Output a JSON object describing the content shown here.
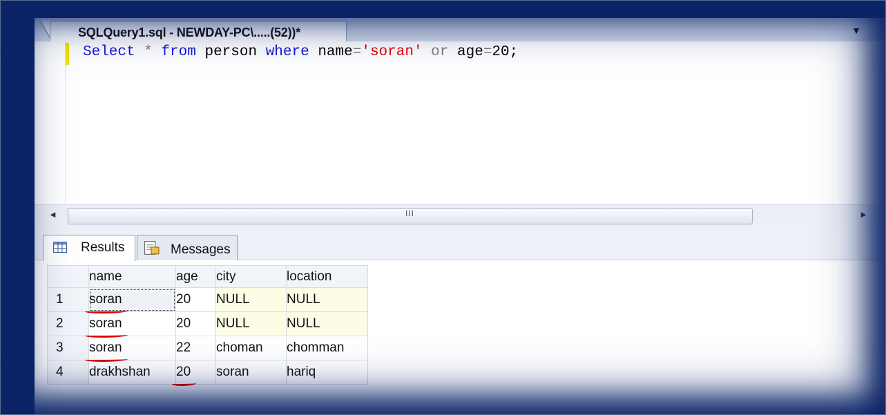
{
  "query_tab": {
    "title": "SQLQuery1.sql - NEWDAY-PC\\.....(52))*"
  },
  "tab_menu": {
    "icon": "dropdown-arrow-icon"
  },
  "editor": {
    "line": [
      {
        "text": "Select",
        "kind": "kw"
      },
      {
        "text": " ",
        "kind": "plain"
      },
      {
        "text": "*",
        "kind": "op"
      },
      {
        "text": " ",
        "kind": "plain"
      },
      {
        "text": "from",
        "kind": "kw"
      },
      {
        "text": " person ",
        "kind": "plain"
      },
      {
        "text": "where",
        "kind": "kw"
      },
      {
        "text": " name",
        "kind": "plain"
      },
      {
        "text": "=",
        "kind": "op"
      },
      {
        "text": "'soran'",
        "kind": "str"
      },
      {
        "text": " ",
        "kind": "plain"
      },
      {
        "text": "or",
        "kind": "op"
      },
      {
        "text": " age",
        "kind": "plain"
      },
      {
        "text": "=",
        "kind": "op"
      },
      {
        "text": "20;",
        "kind": "plain"
      }
    ]
  },
  "hscroll": {
    "grip": "III",
    "left_arrow": "◄",
    "right_arrow": "►"
  },
  "result_tabs": [
    {
      "label": "Results",
      "icon": "grid-icon",
      "active": true
    },
    {
      "label": "Messages",
      "icon": "messages-icon",
      "active": false
    }
  ],
  "grid": {
    "columns": [
      "name",
      "age",
      "city",
      "location"
    ],
    "rows": [
      {
        "num": "1",
        "name": "soran",
        "age": "20",
        "city": "NULL",
        "location": "NULL"
      },
      {
        "num": "2",
        "name": "soran",
        "age": "20",
        "city": "NULL",
        "location": "NULL"
      },
      {
        "num": "3",
        "name": "soran",
        "age": "22",
        "city": "choman",
        "location": "chomman"
      },
      {
        "num": "4",
        "name": "drakhshan",
        "age": "20",
        "city": "soran",
        "location": "hariq"
      }
    ]
  },
  "colors": {
    "frame": "#0b2466",
    "keyword": "#1717d8",
    "string": "#e00000",
    "operator": "#7f7f7f",
    "annotation": "#e00000"
  }
}
